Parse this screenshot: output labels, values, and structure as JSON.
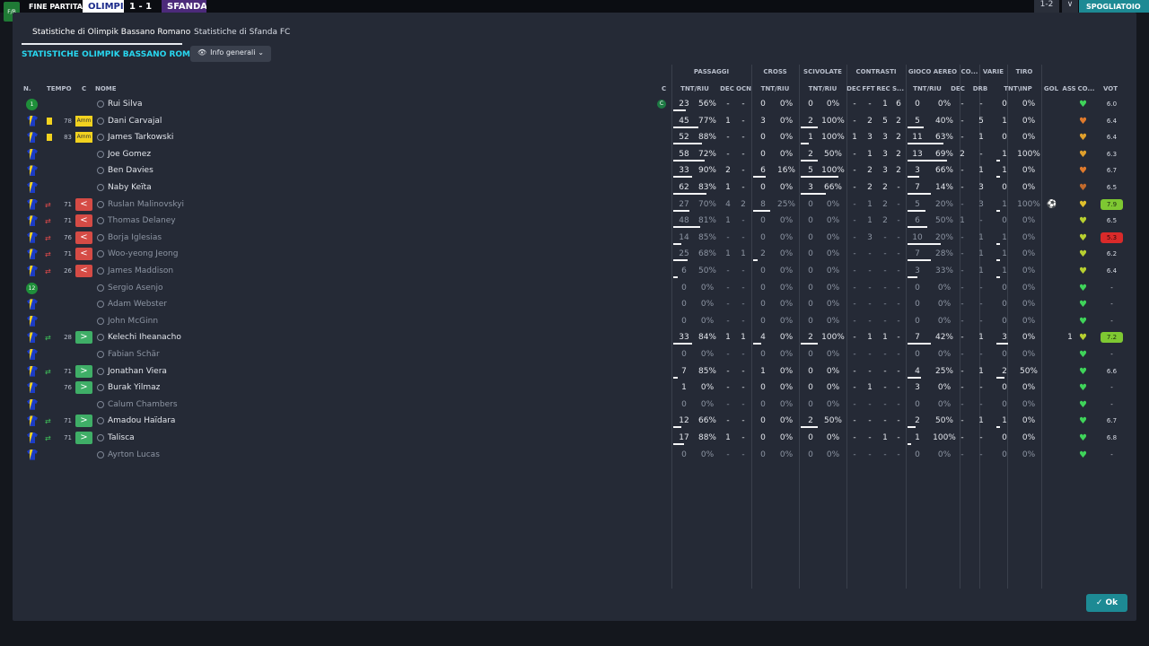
{
  "topbar": {
    "badge": "F/B",
    "label": "FINE PARTITA",
    "team1": "OLIMPI",
    "score": "1 - 1",
    "team2": "SFANDA",
    "right1": "1-2",
    "right2": "∨",
    "right3": "SPOGLIATOIO"
  },
  "tabs": [
    "Statistiche di Olimpik Bassano Romano",
    "Statistiche di Sfanda FC"
  ],
  "section_title": "STATISTICHE OLIMPIK BASSANO ROMANO",
  "dropdown": {
    "label": "Info generali",
    "icon": "eye-icon"
  },
  "groups": [
    "PASSAGGI",
    "CROSS",
    "SCIVOLATE",
    "CONTRASTI",
    "GIOCO AEREO",
    "CO...",
    "VARIE",
    "TIRO"
  ],
  "left_headers": [
    "N.",
    "TEMPO",
    "C",
    "NOME",
    "C"
  ],
  "columns": [
    "TNT/RIU",
    "DEC",
    "OCN",
    "TNT/RIU",
    "TNT/RIU",
    "DEC",
    "FFT",
    "REC",
    "S...",
    "TNT/RIU",
    "DEC",
    "DRB",
    "TNT\\INP",
    "GOL",
    "ASS",
    "CO...",
    "VOT"
  ],
  "ok_label": "Ok",
  "colors": {
    "accent": "#28d7f0",
    "button": "#1d8a94",
    "out": "#d54b45",
    "in": "#3fae67",
    "yellow": "#f2d21f"
  },
  "players": [
    {
      "badge": "gk",
      "badge_text": "1",
      "card": false,
      "sub": "",
      "tempo": "",
      "c": "",
      "name": "Rui Silva",
      "sub_player": false,
      "captain": true,
      "cells": [
        "23",
        "56%",
        "-",
        "-",
        "0",
        "0%",
        "0",
        "0%",
        "-",
        "-",
        "1",
        "6",
        "0",
        "0%",
        "-",
        "-",
        "0",
        "0%",
        "",
        "-"
      ],
      "bar_p": 0.3,
      "bar_c": 0,
      "bar_s": 0,
      "bar_a": 0,
      "bar_t": 0,
      "heart": "#3fd45a",
      "rating": "6.0",
      "rating_style": "plain",
      "goal": ""
    },
    {
      "badge": "shirt",
      "card": true,
      "sub": "",
      "tempo": "78",
      "c": "Amm",
      "name": "Dani Carvajal",
      "sub_player": false,
      "captain": false,
      "cells": [
        "45",
        "77%",
        "1",
        "-",
        "3",
        "0%",
        "2",
        "100%",
        "-",
        "2",
        "5",
        "2",
        "5",
        "40%",
        "-",
        "5",
        "1",
        "0%",
        "",
        "-"
      ],
      "bar_p": 0.6,
      "bar_c": 0,
      "bar_s": 0.4,
      "bar_a": 0.4,
      "bar_t": 0,
      "heart": "#e07a2c",
      "rating": "6.4",
      "rating_style": "plain",
      "goal": ""
    },
    {
      "badge": "shirt",
      "card": true,
      "sub": "",
      "tempo": "83",
      "c": "Amm",
      "name": "James Tarkowski",
      "sub_player": false,
      "captain": false,
      "cells": [
        "52",
        "88%",
        "-",
        "-",
        "0",
        "0%",
        "1",
        "100%",
        "1",
        "3",
        "3",
        "2",
        "11",
        "63%",
        "-",
        "1",
        "0",
        "0%",
        "",
        "-"
      ],
      "bar_p": 0.7,
      "bar_c": 0,
      "bar_s": 0.2,
      "bar_a": 0.9,
      "bar_t": 0,
      "heart": "#e0a02c",
      "rating": "6.4",
      "rating_style": "plain",
      "goal": ""
    },
    {
      "badge": "shirt",
      "card": false,
      "sub": "",
      "tempo": "",
      "c": "",
      "name": "Joe Gomez",
      "sub_player": false,
      "captain": false,
      "cells": [
        "58",
        "72%",
        "-",
        "-",
        "0",
        "0%",
        "2",
        "50%",
        "-",
        "1",
        "3",
        "2",
        "13",
        "69%",
        "2",
        "-",
        "1",
        "100%",
        "",
        "-"
      ],
      "bar_p": 0.75,
      "bar_c": 0,
      "bar_s": 0.4,
      "bar_a": 1,
      "bar_t": 0.1,
      "heart": "#e0a02c",
      "rating": "6.3",
      "rating_style": "plain",
      "goal": ""
    },
    {
      "badge": "shirt",
      "card": false,
      "sub": "",
      "tempo": "",
      "c": "",
      "name": "Ben Davies",
      "sub_player": false,
      "captain": false,
      "cells": [
        "33",
        "90%",
        "2",
        "-",
        "6",
        "16%",
        "5",
        "100%",
        "-",
        "2",
        "3",
        "2",
        "3",
        "66%",
        "-",
        "1",
        "1",
        "0%",
        "",
        "-"
      ],
      "bar_p": 0.45,
      "bar_c": 0.3,
      "bar_s": 0.9,
      "bar_a": 0.3,
      "bar_t": 0.1,
      "heart": "#e07a2c",
      "rating": "6.7",
      "rating_style": "plain",
      "goal": ""
    },
    {
      "badge": "shirt",
      "card": false,
      "sub": "",
      "tempo": "",
      "c": "",
      "name": "Naby Keïta",
      "sub_player": false,
      "captain": false,
      "cells": [
        "62",
        "83%",
        "1",
        "-",
        "0",
        "0%",
        "3",
        "66%",
        "-",
        "2",
        "2",
        "-",
        "7",
        "14%",
        "-",
        "3",
        "0",
        "0%",
        "",
        "-"
      ],
      "bar_p": 0.8,
      "bar_c": 0,
      "bar_s": 0.6,
      "bar_a": 0.6,
      "bar_t": 0,
      "heart": "#c26a2c",
      "rating": "6.5",
      "rating_style": "plain",
      "goal": ""
    },
    {
      "badge": "shirt",
      "card": false,
      "sub": "out",
      "tempo": "71",
      "c": "<",
      "name": "Ruslan Malinovskyi",
      "sub_player": true,
      "captain": false,
      "cells": [
        "27",
        "70%",
        "4",
        "2",
        "8",
        "25%",
        "0",
        "0%",
        "-",
        "1",
        "2",
        "-",
        "5",
        "20%",
        "-",
        "3",
        "1",
        "100%",
        "",
        "-"
      ],
      "bar_p": 0.4,
      "bar_c": 0.4,
      "bar_s": 0,
      "bar_a": 0.45,
      "bar_t": 0.1,
      "heart": "#e0c02c",
      "rating": "7.9",
      "rating_style": "green",
      "goal": "⚽"
    },
    {
      "badge": "shirt",
      "card": false,
      "sub": "out",
      "tempo": "71",
      "c": "<",
      "name": "Thomas Delaney",
      "sub_player": true,
      "captain": false,
      "cells": [
        "48",
        "81%",
        "1",
        "-",
        "0",
        "0%",
        "0",
        "0%",
        "-",
        "1",
        "2",
        "-",
        "6",
        "50%",
        "1",
        "-",
        "0",
        "0%",
        "",
        "-"
      ],
      "bar_p": 0.65,
      "bar_c": 0,
      "bar_s": 0,
      "bar_a": 0.5,
      "bar_t": 0,
      "heart": "#b8d030",
      "rating": "6.5",
      "rating_style": "plain",
      "goal": ""
    },
    {
      "badge": "shirt",
      "card": false,
      "sub": "out",
      "tempo": "76",
      "c": "<",
      "name": "Borja Iglesias",
      "sub_player": true,
      "captain": false,
      "cells": [
        "14",
        "85%",
        "-",
        "-",
        "0",
        "0%",
        "0",
        "0%",
        "-",
        "3",
        "-",
        "-",
        "10",
        "20%",
        "-",
        "1",
        "1",
        "0%",
        "",
        "-"
      ],
      "bar_p": 0.2,
      "bar_c": 0,
      "bar_s": 0,
      "bar_a": 0.85,
      "bar_t": 0.1,
      "heart": "#b8d030",
      "rating": "5.3",
      "rating_style": "red",
      "goal": ""
    },
    {
      "badge": "shirt",
      "card": false,
      "sub": "out",
      "tempo": "71",
      "c": "<",
      "name": "Woo-yeong Jeong",
      "sub_player": true,
      "captain": false,
      "cells": [
        "25",
        "68%",
        "1",
        "1",
        "2",
        "0%",
        "0",
        "0%",
        "-",
        "-",
        "-",
        "-",
        "7",
        "28%",
        "-",
        "1",
        "1",
        "0%",
        "",
        "-"
      ],
      "bar_p": 0.35,
      "bar_c": 0.1,
      "bar_s": 0,
      "bar_a": 0.6,
      "bar_t": 0.1,
      "heart": "#b8d030",
      "rating": "6.2",
      "rating_style": "plain",
      "goal": ""
    },
    {
      "badge": "shirt",
      "card": false,
      "sub": "out",
      "tempo": "26",
      "c": "<",
      "name": "James Maddison",
      "sub_player": true,
      "captain": false,
      "cells": [
        "6",
        "50%",
        "-",
        "-",
        "0",
        "0%",
        "0",
        "0%",
        "-",
        "-",
        "-",
        "-",
        "3",
        "33%",
        "-",
        "1",
        "1",
        "0%",
        "",
        "-"
      ],
      "bar_p": 0.1,
      "bar_c": 0,
      "bar_s": 0,
      "bar_a": 0.25,
      "bar_t": 0.1,
      "heart": "#b8d030",
      "rating": "6.4",
      "rating_style": "plain",
      "goal": ""
    },
    {
      "badge": "gk",
      "badge_text": "12",
      "card": false,
      "sub": "",
      "tempo": "",
      "c": "",
      "name": "Sergio Asenjo",
      "sub_player": true,
      "captain": false,
      "cells": [
        "0",
        "0%",
        "-",
        "-",
        "0",
        "0%",
        "0",
        "0%",
        "-",
        "-",
        "-",
        "-",
        "0",
        "0%",
        "-",
        "-",
        "0",
        "0%",
        "",
        "-"
      ],
      "bar_p": 0,
      "bar_c": 0,
      "bar_s": 0,
      "bar_a": 0,
      "bar_t": 0,
      "heart": "#3fd45a",
      "rating": "-",
      "rating_style": "plain",
      "goal": ""
    },
    {
      "badge": "shirt",
      "card": false,
      "sub": "",
      "tempo": "",
      "c": "",
      "name": "Adam Webster",
      "sub_player": true,
      "captain": false,
      "cells": [
        "0",
        "0%",
        "-",
        "-",
        "0",
        "0%",
        "0",
        "0%",
        "-",
        "-",
        "-",
        "-",
        "0",
        "0%",
        "-",
        "-",
        "0",
        "0%",
        "",
        "-"
      ],
      "bar_p": 0,
      "bar_c": 0,
      "bar_s": 0,
      "bar_a": 0,
      "bar_t": 0,
      "heart": "#3fd45a",
      "rating": "-",
      "rating_style": "plain",
      "goal": ""
    },
    {
      "badge": "shirt",
      "card": false,
      "sub": "",
      "tempo": "",
      "c": "",
      "name": "John McGinn",
      "sub_player": true,
      "captain": false,
      "cells": [
        "0",
        "0%",
        "-",
        "-",
        "0",
        "0%",
        "0",
        "0%",
        "-",
        "-",
        "-",
        "-",
        "0",
        "0%",
        "-",
        "-",
        "0",
        "0%",
        "",
        "-"
      ],
      "bar_p": 0,
      "bar_c": 0,
      "bar_s": 0,
      "bar_a": 0,
      "bar_t": 0,
      "heart": "#3fd45a",
      "rating": "-",
      "rating_style": "plain",
      "goal": ""
    },
    {
      "badge": "shirt",
      "card": false,
      "sub": "in",
      "tempo": "28",
      "c": ">",
      "name": "Kelechi Iheanacho",
      "sub_player": false,
      "captain": false,
      "cells": [
        "33",
        "84%",
        "1",
        "1",
        "4",
        "0%",
        "2",
        "100%",
        "-",
        "1",
        "1",
        "-",
        "7",
        "42%",
        "-",
        "1",
        "3",
        "0%",
        "1",
        "-"
      ],
      "bar_p": 0.45,
      "bar_c": 0.2,
      "bar_s": 0.4,
      "bar_a": 0.6,
      "bar_t": 0.3,
      "heart": "#b8d030",
      "rating": "7.2",
      "rating_style": "green",
      "goal": ""
    },
    {
      "badge": "shirt",
      "card": false,
      "sub": "",
      "tempo": "",
      "c": "",
      "name": "Fabian Schär",
      "sub_player": true,
      "captain": false,
      "cells": [
        "0",
        "0%",
        "-",
        "-",
        "0",
        "0%",
        "0",
        "0%",
        "-",
        "-",
        "-",
        "-",
        "0",
        "0%",
        "-",
        "-",
        "0",
        "0%",
        "",
        "-"
      ],
      "bar_p": 0,
      "bar_c": 0,
      "bar_s": 0,
      "bar_a": 0,
      "bar_t": 0,
      "heart": "#3fd45a",
      "rating": "-",
      "rating_style": "plain",
      "goal": ""
    },
    {
      "badge": "shirt",
      "card": false,
      "sub": "in",
      "tempo": "71",
      "c": ">",
      "name": "Jonathan Viera",
      "sub_player": false,
      "captain": false,
      "cells": [
        "7",
        "85%",
        "-",
        "-",
        "1",
        "0%",
        "0",
        "0%",
        "-",
        "-",
        "-",
        "-",
        "4",
        "25%",
        "-",
        "1",
        "2",
        "50%",
        "",
        "-"
      ],
      "bar_p": 0.1,
      "bar_c": 0,
      "bar_s": 0,
      "bar_a": 0.35,
      "bar_t": 0.2,
      "heart": "#3fd45a",
      "rating": "6.6",
      "rating_style": "plain",
      "goal": ""
    },
    {
      "badge": "shirt",
      "card": false,
      "sub": "",
      "tempo": "76",
      "c": ">",
      "name": "Burak Yilmaz",
      "sub_player": false,
      "captain": false,
      "cells": [
        "1",
        "0%",
        "-",
        "-",
        "0",
        "0%",
        "0",
        "0%",
        "-",
        "1",
        "-",
        "-",
        "3",
        "0%",
        "-",
        "-",
        "0",
        "0%",
        "",
        "-"
      ],
      "bar_p": 0,
      "bar_c": 0,
      "bar_s": 0,
      "bar_a": 0,
      "bar_t": 0,
      "heart": "#3fd45a",
      "rating": "-",
      "rating_style": "plain",
      "goal": ""
    },
    {
      "badge": "shirt",
      "card": false,
      "sub": "",
      "tempo": "",
      "c": "",
      "name": "Calum Chambers",
      "sub_player": true,
      "captain": false,
      "cells": [
        "0",
        "0%",
        "-",
        "-",
        "0",
        "0%",
        "0",
        "0%",
        "-",
        "-",
        "-",
        "-",
        "0",
        "0%",
        "-",
        "-",
        "0",
        "0%",
        "",
        "-"
      ],
      "bar_p": 0,
      "bar_c": 0,
      "bar_s": 0,
      "bar_a": 0,
      "bar_t": 0,
      "heart": "#3fd45a",
      "rating": "-",
      "rating_style": "plain",
      "goal": ""
    },
    {
      "badge": "shirt",
      "card": false,
      "sub": "in",
      "tempo": "71",
      "c": ">",
      "name": "Amadou Haïdara",
      "sub_player": false,
      "captain": false,
      "cells": [
        "12",
        "66%",
        "-",
        "-",
        "0",
        "0%",
        "2",
        "50%",
        "-",
        "-",
        "-",
        "-",
        "2",
        "50%",
        "-",
        "1",
        "1",
        "0%",
        "",
        "-"
      ],
      "bar_p": 0.2,
      "bar_c": 0,
      "bar_s": 0.4,
      "bar_a": 0.2,
      "bar_t": 0.1,
      "heart": "#3fd45a",
      "rating": "6.7",
      "rating_style": "plain",
      "goal": ""
    },
    {
      "badge": "shirt",
      "card": false,
      "sub": "in",
      "tempo": "71",
      "c": ">",
      "name": "Talisca",
      "sub_player": false,
      "captain": false,
      "cells": [
        "17",
        "88%",
        "1",
        "-",
        "0",
        "0%",
        "0",
        "0%",
        "-",
        "-",
        "1",
        "-",
        "1",
        "100%",
        "-",
        "-",
        "0",
        "0%",
        "",
        "-"
      ],
      "bar_p": 0.25,
      "bar_c": 0,
      "bar_s": 0,
      "bar_a": 0.1,
      "bar_t": 0,
      "heart": "#3fd45a",
      "rating": "6.8",
      "rating_style": "plain",
      "goal": ""
    },
    {
      "badge": "shirt",
      "card": false,
      "sub": "",
      "tempo": "",
      "c": "",
      "name": "Ayrton Lucas",
      "sub_player": true,
      "captain": false,
      "cells": [
        "0",
        "0%",
        "-",
        "-",
        "0",
        "0%",
        "0",
        "0%",
        "-",
        "-",
        "-",
        "-",
        "0",
        "0%",
        "-",
        "-",
        "0",
        "0%",
        "",
        "-"
      ],
      "bar_p": 0,
      "bar_c": 0,
      "bar_s": 0,
      "bar_a": 0,
      "bar_t": 0,
      "heart": "#3fd45a",
      "rating": "-",
      "rating_style": "plain",
      "goal": ""
    }
  ]
}
